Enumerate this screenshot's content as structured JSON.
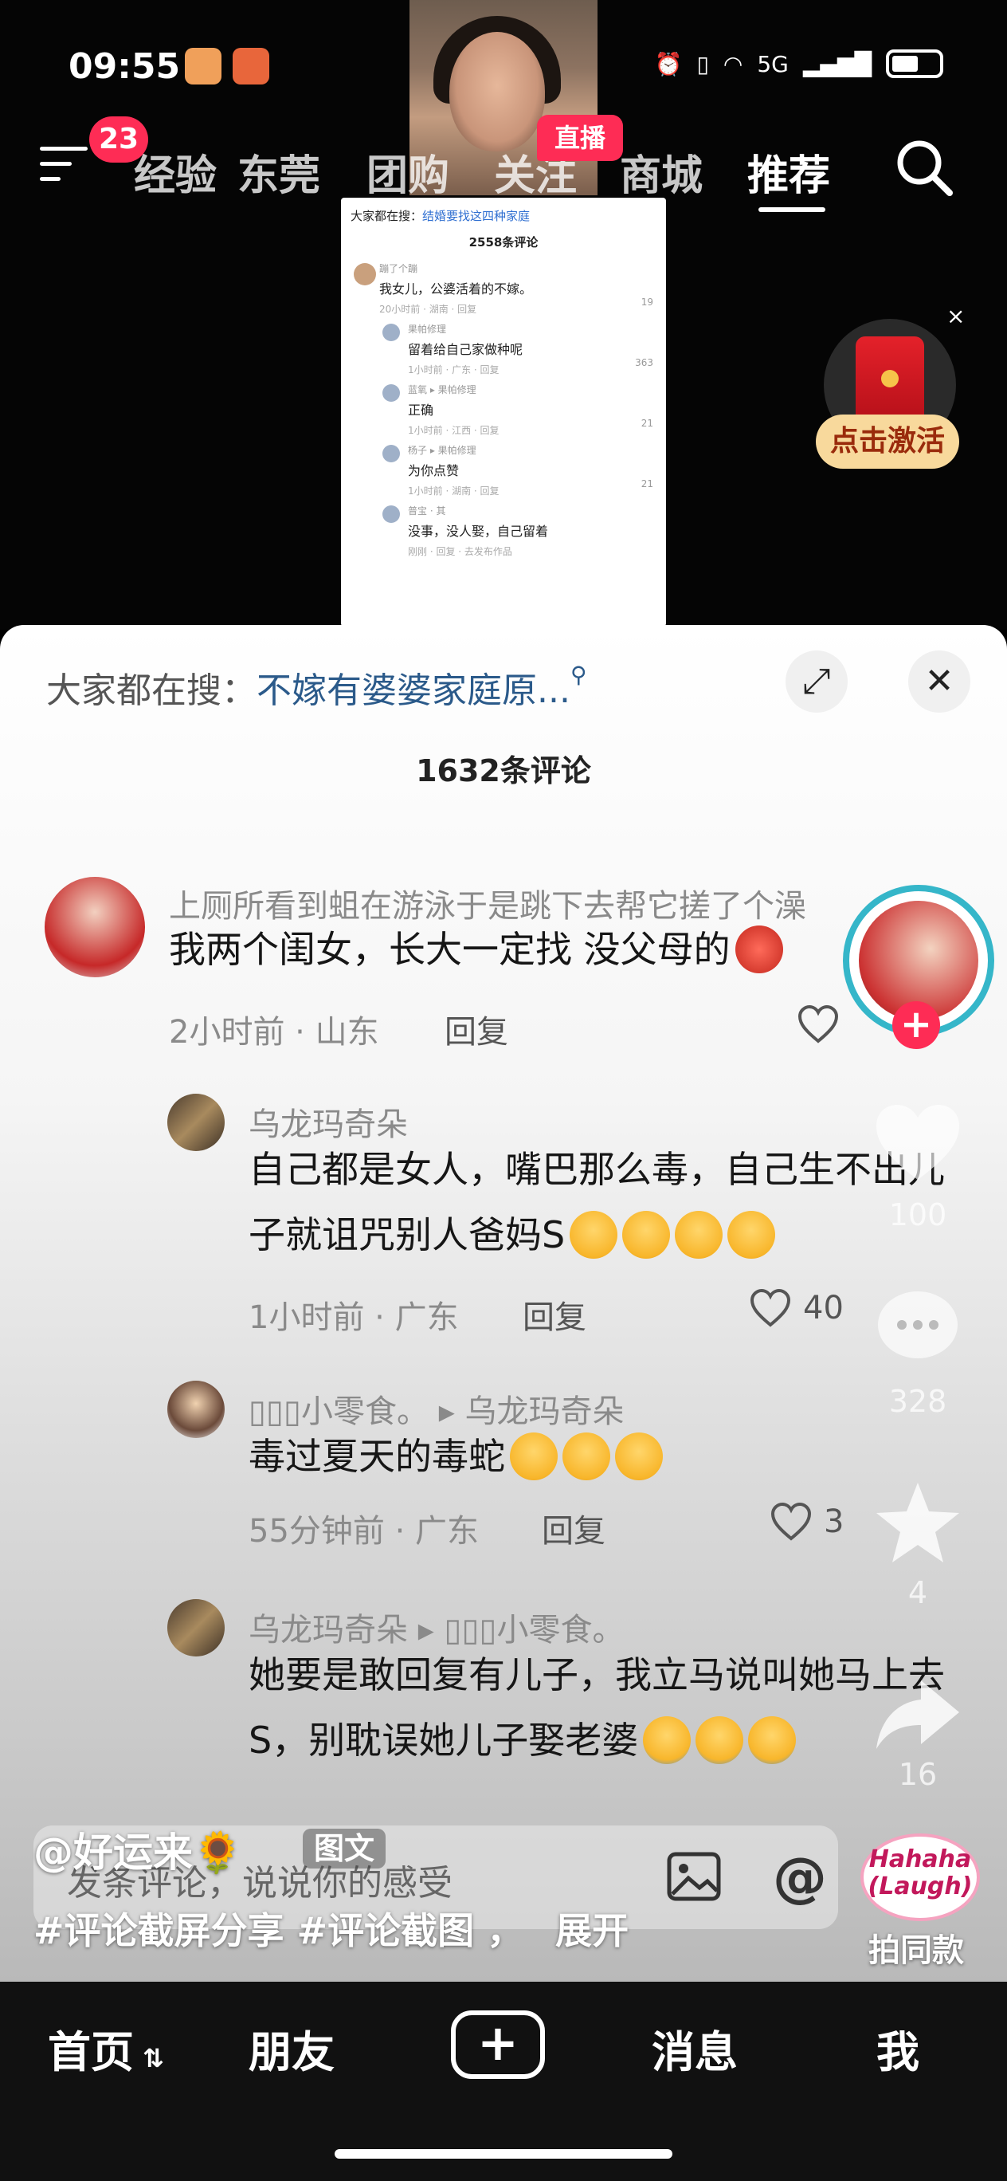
{
  "status_bar": {
    "time": "09:55",
    "network": "5G"
  },
  "top_nav": {
    "menu_badge": "23",
    "tabs": [
      "经验",
      "东莞",
      "团购",
      "关注",
      "商城",
      "推荐"
    ],
    "active_tab": "推荐",
    "live_badge": "直播"
  },
  "embedded_screenshot": {
    "search_prefix": "大家都在搜：",
    "search_term": "结婚要找这四种家庭",
    "count": "2558条评论",
    "comments": [
      {
        "name": "蹦了个蹦",
        "text": "我女儿，公婆活着的不嫁。",
        "meta": "20小时前 · 湖南 · 回复",
        "likes": "19"
      },
      {
        "name": "果帕修理",
        "text": "留着给自己家做种呢",
        "meta": "1小时前 · 广东 · 回复",
        "likes": "363"
      },
      {
        "name": "蓝氧 ▸ 果帕修理",
        "text": "正确",
        "meta": "1小时前 · 江西 · 回复",
        "likes": "21"
      },
      {
        "name": "杨子 ▸ 果帕修理",
        "text": "为你点赞",
        "meta": "1小时前 · 湖南 · 回复",
        "likes": "21"
      },
      {
        "name": "普宝 · 其",
        "text": "没事，没人娶，自己留着",
        "meta": "刚刚 · 回复 · 去发布作品",
        "likes": ""
      }
    ]
  },
  "red_packet": {
    "label": "点击激活",
    "close": "×"
  },
  "sheet": {
    "search_prefix": "大家都在搜：",
    "search_term": "不嫁有婆婆家庭原...",
    "comment_count": "1632条评论",
    "comments": [
      {
        "name": "上厕所看到蛆在游泳于是跳下去帮它搓了个澡",
        "text": "我两个闺女，长大一定找 没父母的",
        "time": "2小时前 · 山东",
        "reply": "回复",
        "likes": ""
      },
      {
        "name": "乌龙玛奇朵",
        "text": "自己都是女人，嘴巴那么毒，自己生不出儿子就诅咒别人爸妈S",
        "time": "1小时前 · 广东",
        "reply": "回复",
        "likes": "40"
      },
      {
        "name": "▯▯▯小零食。 ▸ 乌龙玛奇朵",
        "text": "毒过夏天的毒蛇",
        "time": "55分钟前 · 广东",
        "reply": "回复",
        "likes": "3"
      },
      {
        "name": "乌龙玛奇朵 ▸ ▯▯▯小零食。",
        "text": "她要是敢回复有儿子，我立马说叫她马上去S，别耽误她儿子娶老婆",
        "time": "",
        "reply": "",
        "likes": ""
      }
    ]
  },
  "right_rail": {
    "likes": "100",
    "comments": "328",
    "favorites": "4",
    "shares": "16"
  },
  "caption": {
    "author": "@好运来🌻",
    "type_tag": "图文",
    "hashtags": "#评论截屏分享 #评论截图 ，",
    "expand": "展开",
    "same_style": "拍同款",
    "music_label": "Hahaha (Laugh)"
  },
  "comment_input": {
    "placeholder": "发条评论，说说你的感受"
  },
  "tabbar": {
    "home": "首页",
    "friends": "朋友",
    "publish": "+",
    "messages": "消息",
    "me": "我"
  }
}
